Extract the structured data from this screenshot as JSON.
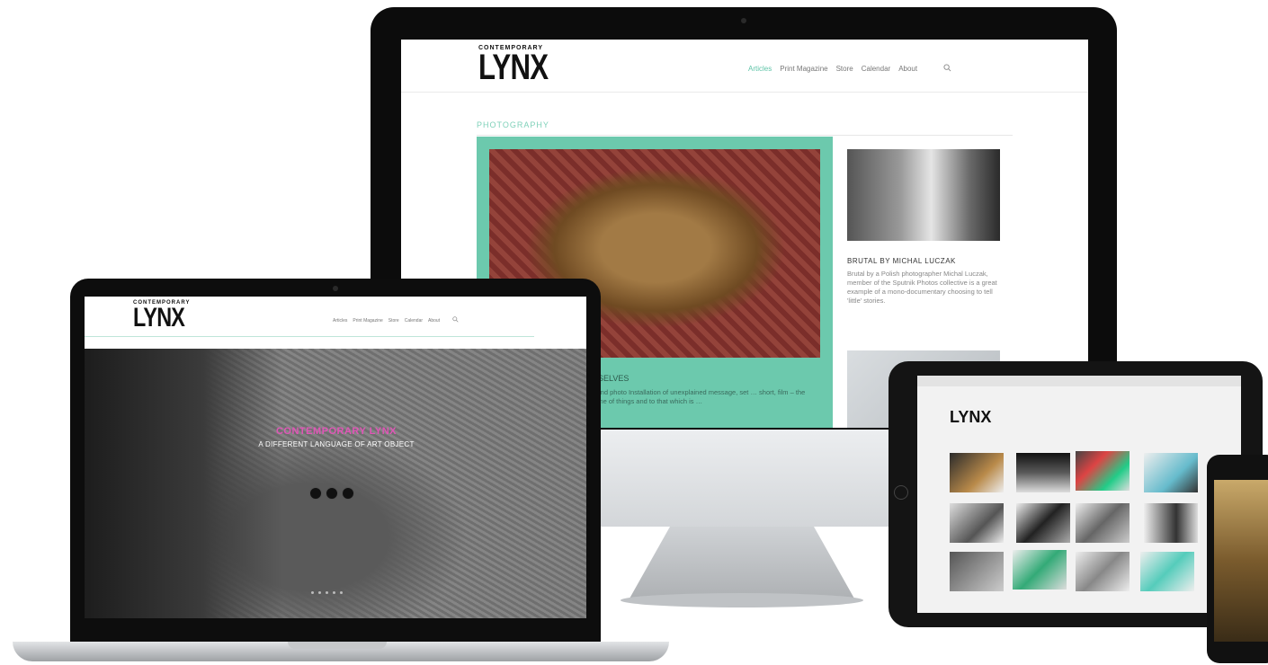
{
  "desktop": {
    "logo_small": "CONTEMPORARY",
    "logo_big": "LYNX",
    "nav": [
      "Articles",
      "Print Magazine",
      "Store",
      "Calendar",
      "About"
    ],
    "section_label": "PHOTOGRAPHY",
    "feature_caption": "…SELVES",
    "feature_text": "…and photo Installation of unexplained message, set … short, film – the name of things and to that which is …",
    "side_title": "BRUTAL BY MICHAL LUCZAK",
    "side_text": "Brutal by a Polish photographer Michal Luczak, member of the Sputnik Photos collective is a great example of a mono-documentary choosing to tell 'little' stories."
  },
  "laptop": {
    "logo_small": "CONTEMPORARY",
    "logo_big": "LYNX",
    "nav": [
      "Articles",
      "Print Magazine",
      "Store",
      "Calendar",
      "About"
    ],
    "hero_title": "CONTEMPORARY LYNX",
    "hero_sub": "A DIFFERENT LANGUAGE OF ART OBJECT"
  },
  "tablet": {
    "logo": "LYNX"
  }
}
